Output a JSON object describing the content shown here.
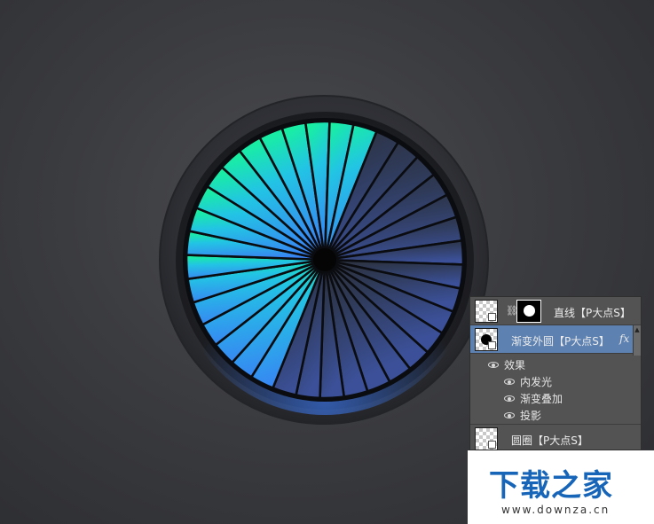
{
  "canvas": {
    "background_color": "#3b3c40",
    "spoke_count": 36,
    "gradient_colors": {
      "top": "#18f0a0",
      "left": "#22c4e4",
      "bottom": "#3a8cf2",
      "right": "#3b4c8c"
    },
    "highlighted_arc_degrees": [
      -90,
      22
    ],
    "dark_segment_color": "#2e3a4a",
    "divider_color": "#0a0c10"
  },
  "layers_panel": {
    "layers": [
      {
        "name": "直线【P大点S】",
        "thumbnail_icon": "checkered-thumbnail-icon",
        "has_mask": true,
        "mask_icon": "white-circle-mask-icon"
      },
      {
        "name": "渐变外圆【P大点S】",
        "thumbnail_icon": "black-circle-thumbnail-icon",
        "selected": true,
        "fx_label": "fx"
      },
      {
        "name": "圆圈【P大点S】",
        "thumbnail_icon": "checkered-thumbnail-icon"
      }
    ],
    "effects_header": "效果",
    "effects": [
      "内发光",
      "渐变叠加",
      "投影"
    ],
    "eye_icon": "eye-icon",
    "selected_color": "#5d81b0"
  },
  "watermark": {
    "title": "下载之家",
    "url": "www.downza.cn",
    "title_color": "#1665b8"
  }
}
